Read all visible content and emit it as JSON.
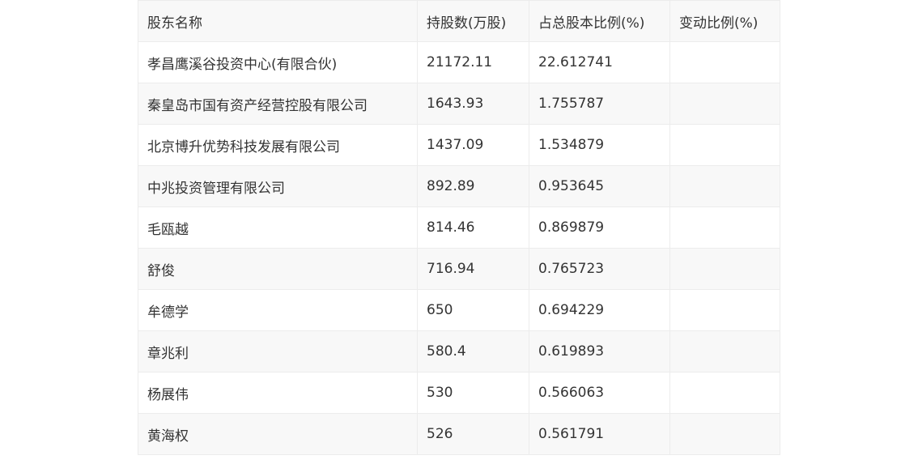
{
  "table": {
    "headers": [
      "股东名称",
      "持股数(万股)",
      "占总股本比例(%)",
      "变动比例(%)"
    ],
    "rows": [
      {
        "name": "孝昌鹰溪谷投资中心(有限合伙)",
        "shares": "21172.11",
        "ratio": "22.612741",
        "change": ""
      },
      {
        "name": "秦皇岛市国有资产经营控股有限公司",
        "shares": "1643.93",
        "ratio": "1.755787",
        "change": ""
      },
      {
        "name": "北京博升优势科技发展有限公司",
        "shares": "1437.09",
        "ratio": "1.534879",
        "change": ""
      },
      {
        "name": "中兆投资管理有限公司",
        "shares": "892.89",
        "ratio": "0.953645",
        "change": ""
      },
      {
        "name": "毛瓯越",
        "shares": "814.46",
        "ratio": "0.869879",
        "change": ""
      },
      {
        "name": "舒俊",
        "shares": "716.94",
        "ratio": "0.765723",
        "change": ""
      },
      {
        "name": "牟德学",
        "shares": "650",
        "ratio": "0.694229",
        "change": ""
      },
      {
        "name": "章兆利",
        "shares": "580.4",
        "ratio": "0.619893",
        "change": ""
      },
      {
        "name": "杨展伟",
        "shares": "530",
        "ratio": "0.566063",
        "change": ""
      },
      {
        "name": "黄海权",
        "shares": "526",
        "ratio": "0.561791",
        "change": ""
      }
    ]
  }
}
